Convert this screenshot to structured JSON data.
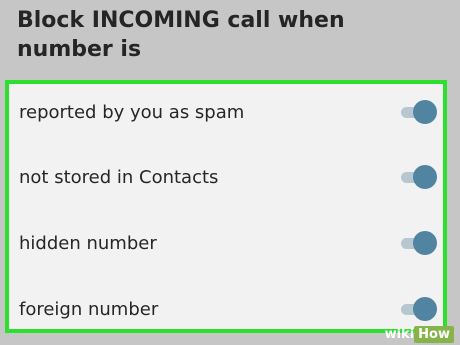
{
  "title": "Block INCOMING call when number is",
  "options": [
    {
      "label": "reported by you as spam",
      "enabled": true
    },
    {
      "label": "not stored in Contacts",
      "enabled": true
    },
    {
      "label": "hidden number",
      "enabled": true
    },
    {
      "label": "foreign number",
      "enabled": true
    }
  ],
  "watermark": {
    "part1": "wiki",
    "part2": "How"
  },
  "colors": {
    "background": "#c6c6c6",
    "panel": "#f2f2f2",
    "highlight_border": "#2ee02e",
    "toggle_thumb": "#5184a0",
    "toggle_track": "#b7c7d1"
  }
}
